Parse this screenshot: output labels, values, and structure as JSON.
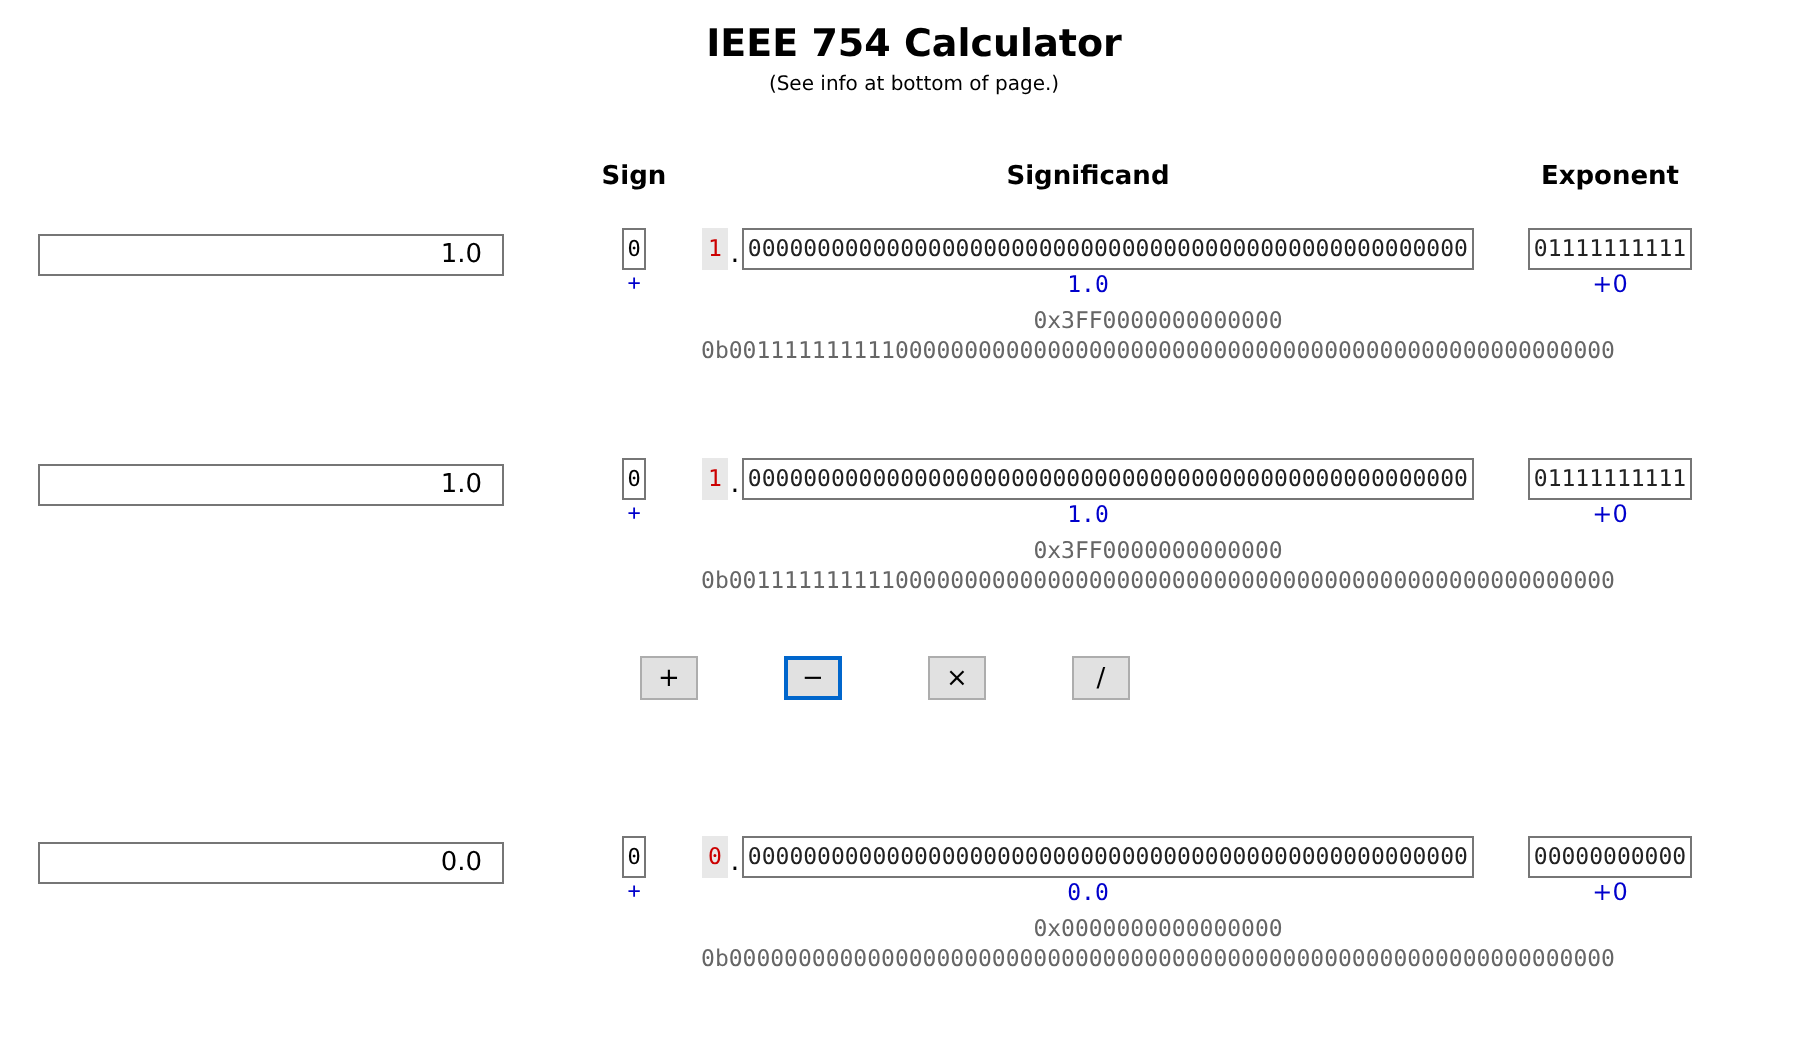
{
  "title": "IEEE 754 Calculator",
  "subtitle": "(See info at bottom of page.)",
  "headers": {
    "sign": "Sign",
    "significand": "Significand",
    "exponent": "Exponent"
  },
  "rows": [
    {
      "decimal": "1.0",
      "sign": "0",
      "sign_symbol": "+",
      "leading_bit": "1",
      "radix_point": ".",
      "significand": "0000000000000000000000000000000000000000000000000000",
      "significand_value": "1.0",
      "exponent": "01111111111",
      "exponent_value": "+0",
      "hex": "0x3FF0000000000000",
      "binary": "0b0011111111110000000000000000000000000000000000000000000000000000"
    },
    {
      "decimal": "1.0",
      "sign": "0",
      "sign_symbol": "+",
      "leading_bit": "1",
      "radix_point": ".",
      "significand": "0000000000000000000000000000000000000000000000000000",
      "significand_value": "1.0",
      "exponent": "01111111111",
      "exponent_value": "+0",
      "hex": "0x3FF0000000000000",
      "binary": "0b0011111111110000000000000000000000000000000000000000000000000000"
    },
    {
      "decimal": "0.0",
      "sign": "0",
      "sign_symbol": "+",
      "leading_bit": "0",
      "radix_point": ".",
      "significand": "0000000000000000000000000000000000000000000000000000",
      "significand_value": "0.0",
      "exponent": "00000000000",
      "exponent_value": "+0",
      "hex": "0x0000000000000000",
      "binary": "0b0000000000000000000000000000000000000000000000000000000000000000"
    }
  ],
  "operations": [
    {
      "label": "+",
      "selected": false
    },
    {
      "label": "−",
      "selected": true
    },
    {
      "label": "×",
      "selected": false
    },
    {
      "label": "/",
      "selected": false
    }
  ]
}
